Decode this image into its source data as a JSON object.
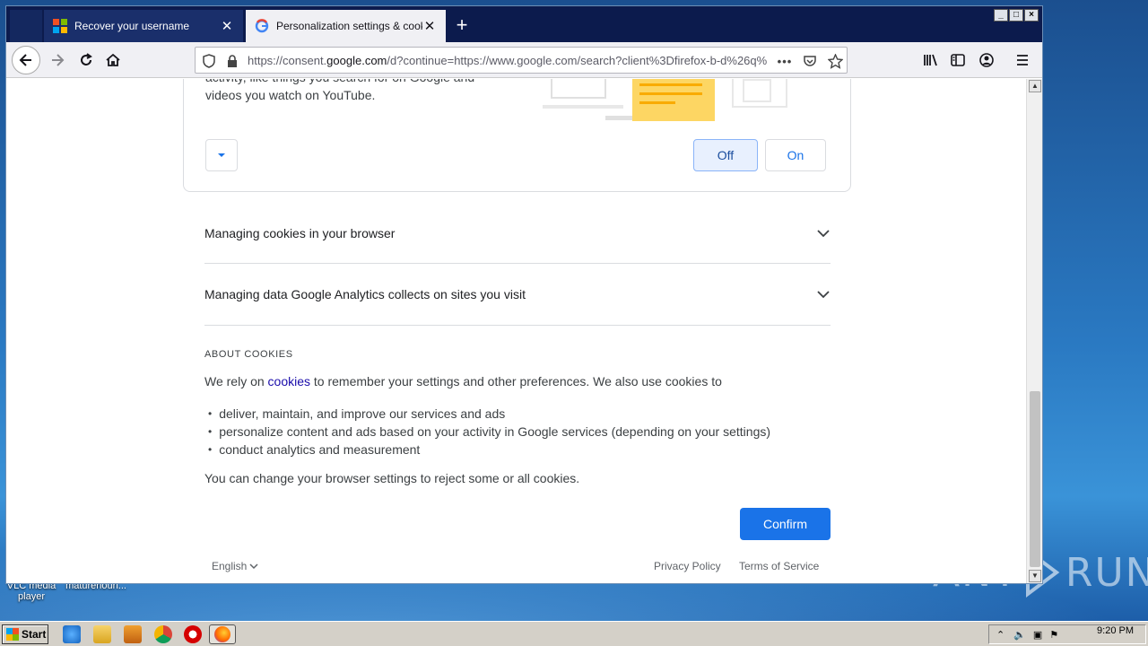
{
  "browser": {
    "tabs": [
      {
        "title": "Recover your username",
        "active": false
      },
      {
        "title": "Personalization settings & cookies",
        "active": true
      }
    ],
    "url": {
      "prefix": "https://consent.",
      "domain": "google.com",
      "rest": "/d?continue=https://www.google.com/search?client%3Dfirefox-b-d%26q%"
    },
    "window_controls": [
      "_",
      "□",
      "×"
    ]
  },
  "card": {
    "text_line1": "activity, like things you search for on Google and",
    "text_line2": "videos you watch on YouTube.",
    "off_label": "Off",
    "on_label": "On"
  },
  "sections": [
    {
      "label": "Managing cookies in your browser"
    },
    {
      "label": "Managing data Google Analytics collects on sites you visit"
    }
  ],
  "about": {
    "heading": "ABOUT COOKIES",
    "intro_before": "We rely on ",
    "intro_link": "cookies",
    "intro_after": " to remember your settings and other preferences. We also use cookies to",
    "bullets": [
      "deliver, maintain, and improve our services and ads",
      "personalize content and ads based on your activity in Google services (depending on your settings)",
      "conduct analytics and measurement"
    ],
    "closing": "You can change your browser settings to reject some or all cookies."
  },
  "confirm_label": "Confirm",
  "footer": {
    "language": "English",
    "privacy": "Privacy Policy",
    "terms": "Terms of Service"
  },
  "desktop": {
    "icons": [
      {
        "label_line1": "VLC media",
        "label_line2": "player"
      },
      {
        "label_line1": "maturehouri..."
      }
    ],
    "watermark_left": "ANY",
    "watermark_right": "RUN"
  },
  "taskbar": {
    "start_label": "Start",
    "clock": "9:20 PM"
  },
  "colors": {
    "accent": "#1a73e8",
    "tab_bar": "#0c1b4d"
  }
}
